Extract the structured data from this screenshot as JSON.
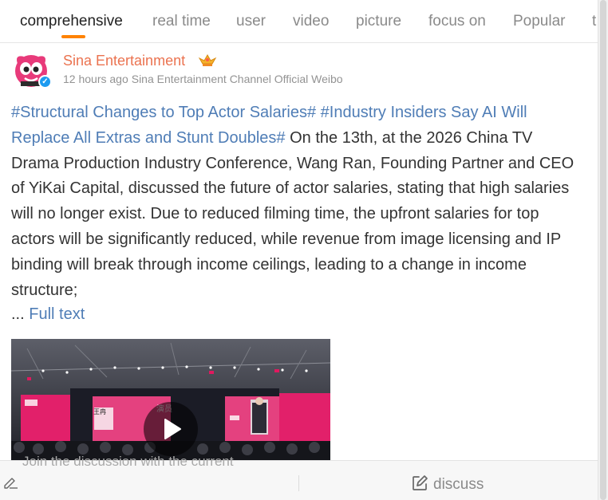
{
  "tabs": [
    {
      "label": "comprehensive",
      "active": true
    },
    {
      "label": "real time"
    },
    {
      "label": "user"
    },
    {
      "label": "video"
    },
    {
      "label": "picture"
    },
    {
      "label": "focus on"
    },
    {
      "label": "Popular"
    },
    {
      "label": "t"
    }
  ],
  "post": {
    "author": "Sina Entertainment",
    "time": "12 hours ago",
    "source": "Sina Entertainment Channel Official Weibo",
    "topic1": "#Structural Changes to Top Actor Salaries#",
    "topic2": "#Industry Insiders Say AI Will Replace All Extras and Stunt Doubles#",
    "body": "On the 13th, at the 2026 China TV Drama Production Industry Conference, Wang Ran, Founding Partner and CEO of YiKai Capital, discussed the future of actor salaries, stating that high salaries will no longer exist. Due to reduced filming time, the upfront salaries for top actors will be significantly reduced, while revenue from image licensing and IP binding will break through income ceilings, leading to a change in income structure;",
    "ellipsis": "...",
    "full_text": "Full text"
  },
  "video": {
    "screen_text_1": "演员",
    "screen_text_2": "王冉"
  },
  "comment_bar": {
    "hint": "Join the discussion with the current",
    "discuss_label": "discuss"
  },
  "colors": {
    "accent": "#ff8200",
    "author": "#eb7350",
    "link": "#4f7db6"
  }
}
